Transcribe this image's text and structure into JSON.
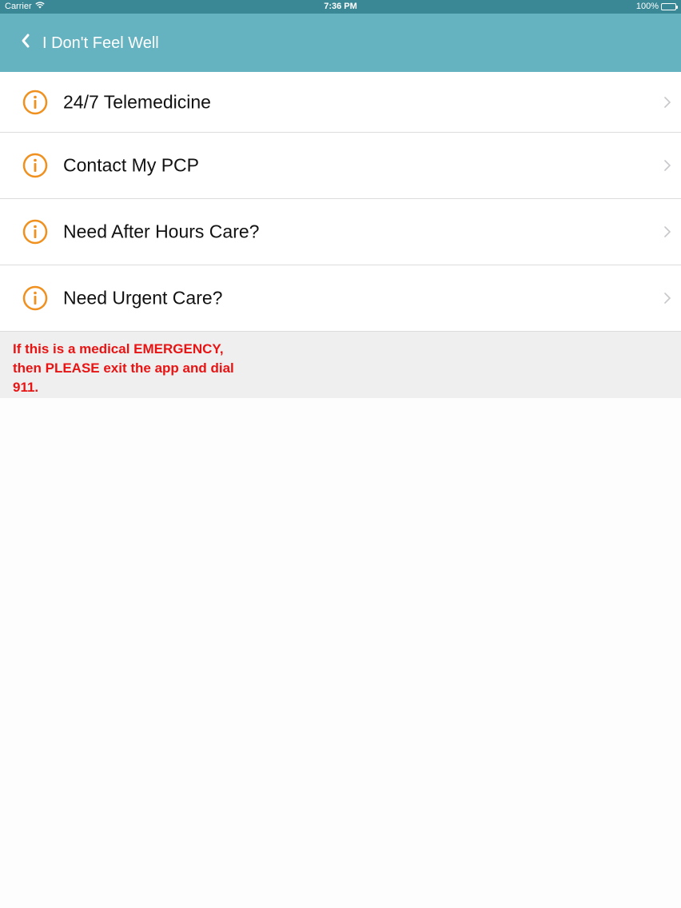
{
  "status_bar": {
    "carrier": "Carrier",
    "time": "7:36 PM",
    "battery": "100%",
    "wifi_icon": "wifi-icon",
    "battery_icon": "battery-icon"
  },
  "nav": {
    "title": "I Don't Feel Well",
    "back_icon": "chevron-left-icon",
    "background": "#65b3c1"
  },
  "menu": {
    "items": [
      {
        "label": "24/7 Telemedicine",
        "icon": "info-icon"
      },
      {
        "label": "Contact My PCP",
        "icon": "info-icon"
      },
      {
        "label": "Need After Hours Care?",
        "icon": "info-icon"
      },
      {
        "label": "Need Urgent Care?",
        "icon": "info-icon"
      }
    ],
    "icon_color": "#f0901e",
    "chevron_icon": "chevron-right-icon"
  },
  "warning": {
    "text": "If this is a medical EMERGENCY, then PLEASE exit the app and dial 911.",
    "color": "#e81414"
  }
}
